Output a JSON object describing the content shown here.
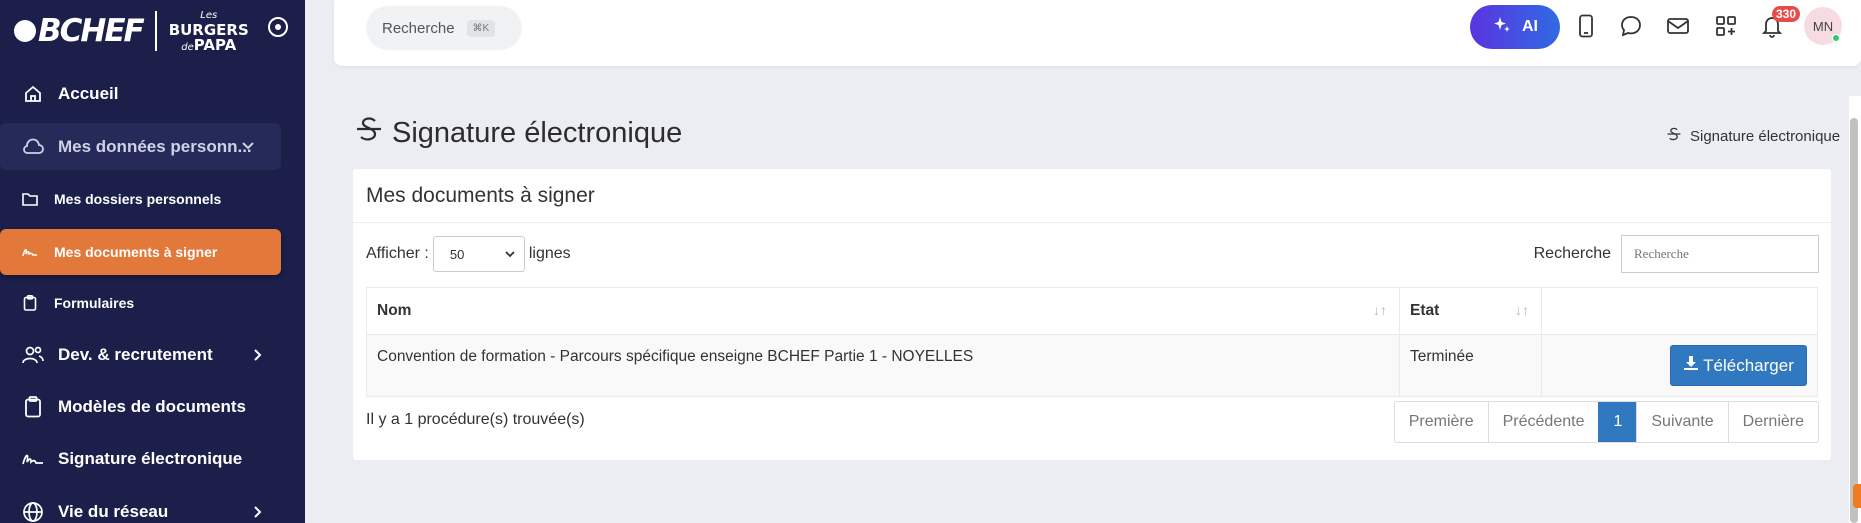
{
  "sidebar": {
    "logo_left": "BCHEF",
    "logo_right_top": "Les",
    "logo_right_main": "BURGERS",
    "logo_right_de": "de",
    "logo_right_bottom": "PAPA",
    "items": [
      {
        "label": "Accueil",
        "icon": "home-icon"
      },
      {
        "label": "Mes données personn...",
        "icon": "cloud-icon"
      },
      {
        "label": "Mes dossiers personnels",
        "icon": "folder-icon"
      },
      {
        "label": "Mes documents à signer",
        "icon": "signature-icon"
      },
      {
        "label": "Formulaires",
        "icon": "clipboard-icon"
      },
      {
        "label": "Dev. & recrutement",
        "icon": "users-icon"
      },
      {
        "label": "Modèles de documents",
        "icon": "clipboard-icon"
      },
      {
        "label": "Signature électronique",
        "icon": "signature-icon"
      },
      {
        "label": "Vie du réseau",
        "icon": "globe-icon"
      }
    ]
  },
  "topbar": {
    "search_label": "Recherche",
    "search_shortcut": "⌘K",
    "ai_label": "AI",
    "notif_count": "330",
    "avatar_initials": "MN"
  },
  "page": {
    "title": "Signature électronique",
    "breadcrumb": "Signature électronique",
    "card_title": "Mes documents à signer",
    "show_label": "Afficher :",
    "show_value": "50",
    "show_suffix": "lignes",
    "search_label": "Recherche",
    "search_placeholder": "Recherche",
    "columns": [
      "Nom",
      "Etat"
    ],
    "rows": [
      {
        "nom": "Convention de formation - Parcours spécifique enseigne BCHEF Partie 1 - NOYELLES",
        "etat": "Terminée",
        "action": "Télécharger"
      }
    ],
    "found_text": "Il y a 1 procédure(s) trouvée(s)",
    "pager": [
      "Première",
      "Précédente",
      "1",
      "Suivante",
      "Dernière"
    ]
  },
  "colors": {
    "sidebar_bg": "#1b1f4a",
    "active_item": "#e2783a",
    "primary_blue": "#3078c0"
  }
}
